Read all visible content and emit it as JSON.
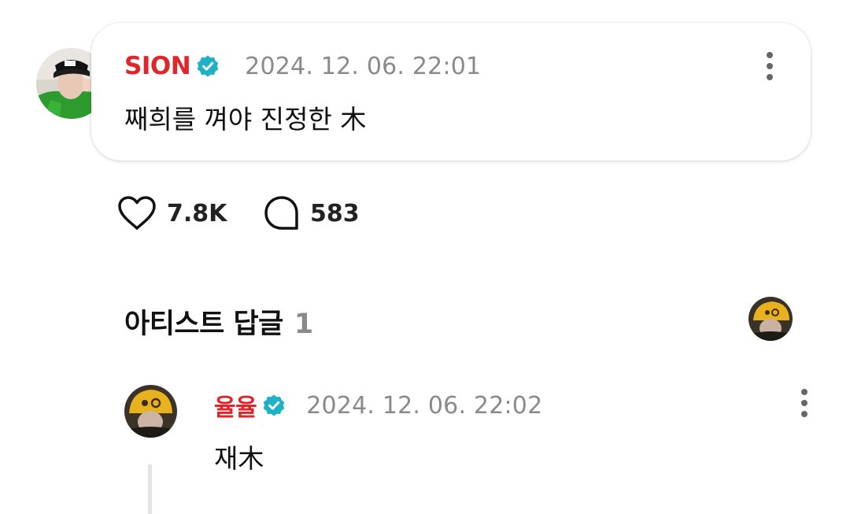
{
  "post": {
    "author": "SION",
    "verified": true,
    "timestamp": "2024. 12. 06. 22:01",
    "text": "째희를 껴야 진정한 木",
    "likes": "7.8K",
    "comments": "583"
  },
  "artist_replies": {
    "title": "아티스트 답글",
    "count": "1",
    "replies": [
      {
        "author": "율율",
        "verified": true,
        "timestamp": "2024. 12. 06. 22:02",
        "text": "재木"
      }
    ]
  },
  "colors": {
    "author_name": "#e0262b",
    "verified_badge": "#1fb2c7",
    "timestamp": "#8a8a8a",
    "reply_count": "#8a8a8a"
  },
  "icons": {
    "verified": "verified-badge-icon",
    "more": "more-vertical-icon",
    "like": "heart-outline-icon",
    "comment": "speech-bubble-outline-icon"
  }
}
